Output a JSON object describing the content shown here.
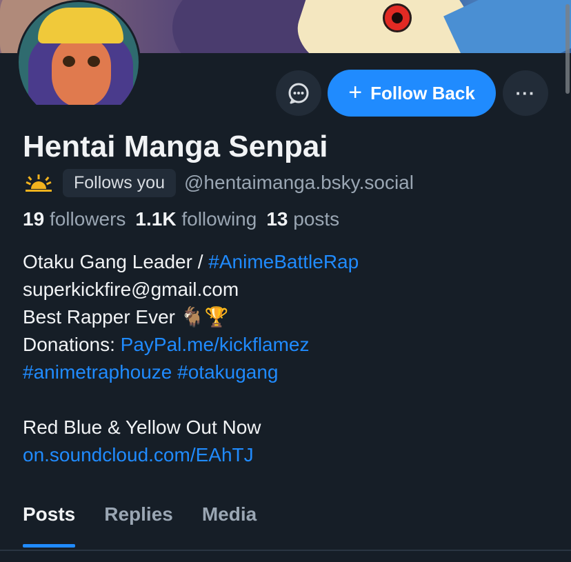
{
  "profile": {
    "display_name": "Hentai Manga Senpai",
    "sun_icon": "sun-icon",
    "follows_you": "Follows you",
    "handle": "@hentaimanga.bsky.social"
  },
  "actions": {
    "message_icon": "message-icon",
    "follow_back_label": "Follow Back",
    "more_label": "···"
  },
  "stats": {
    "followers_count": "19",
    "followers_label": "followers",
    "following_count": "1.1K",
    "following_label": "following",
    "posts_count": "13",
    "posts_label": "posts"
  },
  "bio": {
    "line1_text": "Otaku Gang Leader / ",
    "line1_hashtag": "#AnimeBattleRap",
    "line2": "superkickfire@gmail.com",
    "line3": "Best Rapper Ever  🐐🏆",
    "line4_text": "Donations: ",
    "line4_link": "PayPal.me/kickflamez",
    "line5": " #animetraphouze #otakugang",
    "line7": "Red Blue & Yellow Out Now",
    "line8": "on.soundcloud.com/EAhTJ"
  },
  "tabs": [
    {
      "label": "Posts",
      "active": true
    },
    {
      "label": "Replies",
      "active": false
    },
    {
      "label": "Media",
      "active": false
    }
  ],
  "colors": {
    "accent": "#208bfe",
    "background": "#161e27",
    "muted": "#9aa6b3"
  }
}
